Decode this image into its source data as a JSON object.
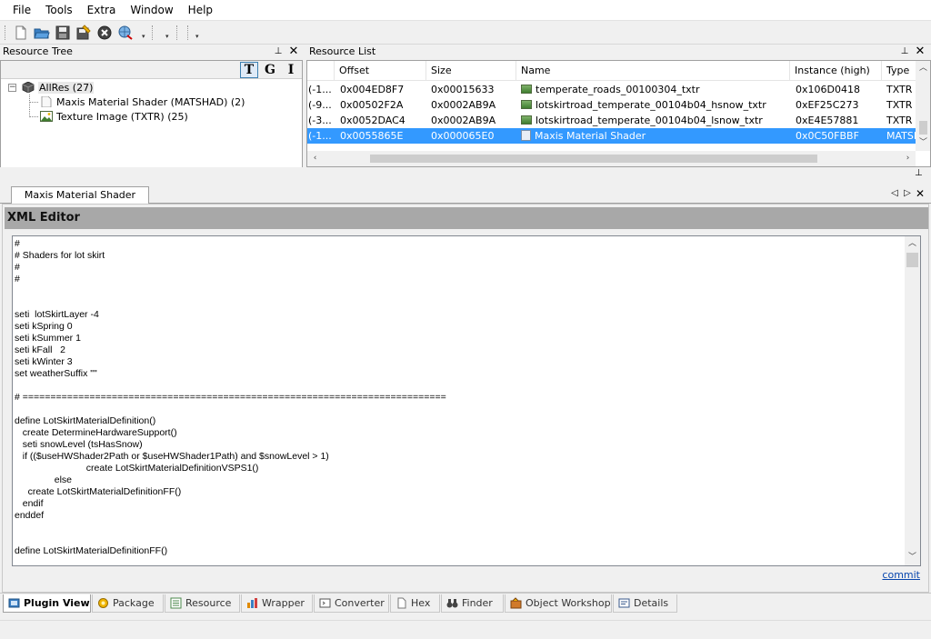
{
  "menu": [
    "File",
    "Tools",
    "Extra",
    "Window",
    "Help"
  ],
  "toolbar": {
    "icons": [
      "new-file-icon",
      "open-folder-icon",
      "save-icon",
      "save-as-icon",
      "close-circle-icon",
      "search-globe-icon"
    ]
  },
  "resource_tree": {
    "title": "Resource Tree",
    "view_buttons": [
      "T",
      "G",
      "I"
    ],
    "root": "AllRes (27)",
    "children": [
      {
        "label": "Maxis Material Shader (MATSHAD) (2)",
        "icon": "document-icon"
      },
      {
        "label": "Texture Image (TXTR) (25)",
        "icon": "image-icon"
      }
    ]
  },
  "resource_list": {
    "title": "Resource List",
    "columns": [
      "",
      "Offset",
      "Size",
      "Name",
      "Instance (high)",
      "Type"
    ],
    "rows": [
      {
        "c0": "(-1...",
        "offset": "0x004ED8F7",
        "size": "0x00015633",
        "name": "temperate_roads_00100304_txtr",
        "instance": "0x106D0418",
        "type": "TXTR",
        "icon": "image-icon",
        "selected": false
      },
      {
        "c0": "(-9...",
        "offset": "0x00502F2A",
        "size": "0x0002AB9A",
        "name": "lotskirtroad_temperate_00104b04_hsnow_txtr",
        "instance": "0xEF25C273",
        "type": "TXTR",
        "icon": "image-icon",
        "selected": false
      },
      {
        "c0": "(-3...",
        "offset": "0x0052DAC4",
        "size": "0x0002AB9A",
        "name": "lotskirtroad_temperate_00104b04_lsnow_txtr",
        "instance": "0xE4E57881",
        "type": "TXTR",
        "icon": "image-icon",
        "selected": false
      },
      {
        "c0": "(-1...",
        "offset": "0x0055865E",
        "size": "0x000065E0",
        "name": "Maxis Material Shader",
        "instance": "0x0C50FBBF",
        "type": "MATSI",
        "icon": "document-icon",
        "selected": true
      }
    ]
  },
  "document": {
    "tab_label": "Maxis Material Shader",
    "editor_title": "XML Editor",
    "content": "#\n# Shaders for lot skirt\n#\n#\n\n\nseti  lotSkirtLayer -4\nseti kSpring 0\nseti kSummer 1\nseti kFall   2\nseti kWinter 3\nset weatherSuffix \"\"\n\n# ============================================================================\n\ndefine LotSkirtMaterialDefinition()\n   create DetermineHardwareSupport()\n   seti snowLevel (tsHasSnow)\n   if (($useHWShader2Path or $useHWShader1Path) and $snowLevel > 1)\n                           create LotSkirtMaterialDefinitionVSPS1()\n               else\n     create LotSkirtMaterialDefinitionFF()\n   endif\nenddef\n\n\ndefine LotSkirtMaterialDefinitionFF()",
    "commit_label": "commit"
  },
  "bottom_tabs": [
    {
      "label": "Plugin View",
      "icon": "plugin-view-icon",
      "active": true
    },
    {
      "label": "Package",
      "icon": "package-icon",
      "active": false
    },
    {
      "label": "Resource",
      "icon": "resource-icon",
      "active": false
    },
    {
      "label": "Wrapper",
      "icon": "wrapper-icon",
      "active": false
    },
    {
      "label": "Converter",
      "icon": "converter-icon",
      "active": false
    },
    {
      "label": "Hex",
      "icon": "hex-icon",
      "active": false
    },
    {
      "label": "Finder",
      "icon": "binoculars-icon",
      "active": false
    },
    {
      "label": "Object Workshop",
      "icon": "object-workshop-icon",
      "active": false
    },
    {
      "label": "Details",
      "icon": "details-icon",
      "active": false
    }
  ],
  "colors": {
    "selection": "#3399ff",
    "editor_title_bg": "#a8a8a8",
    "link": "#0645ad"
  }
}
